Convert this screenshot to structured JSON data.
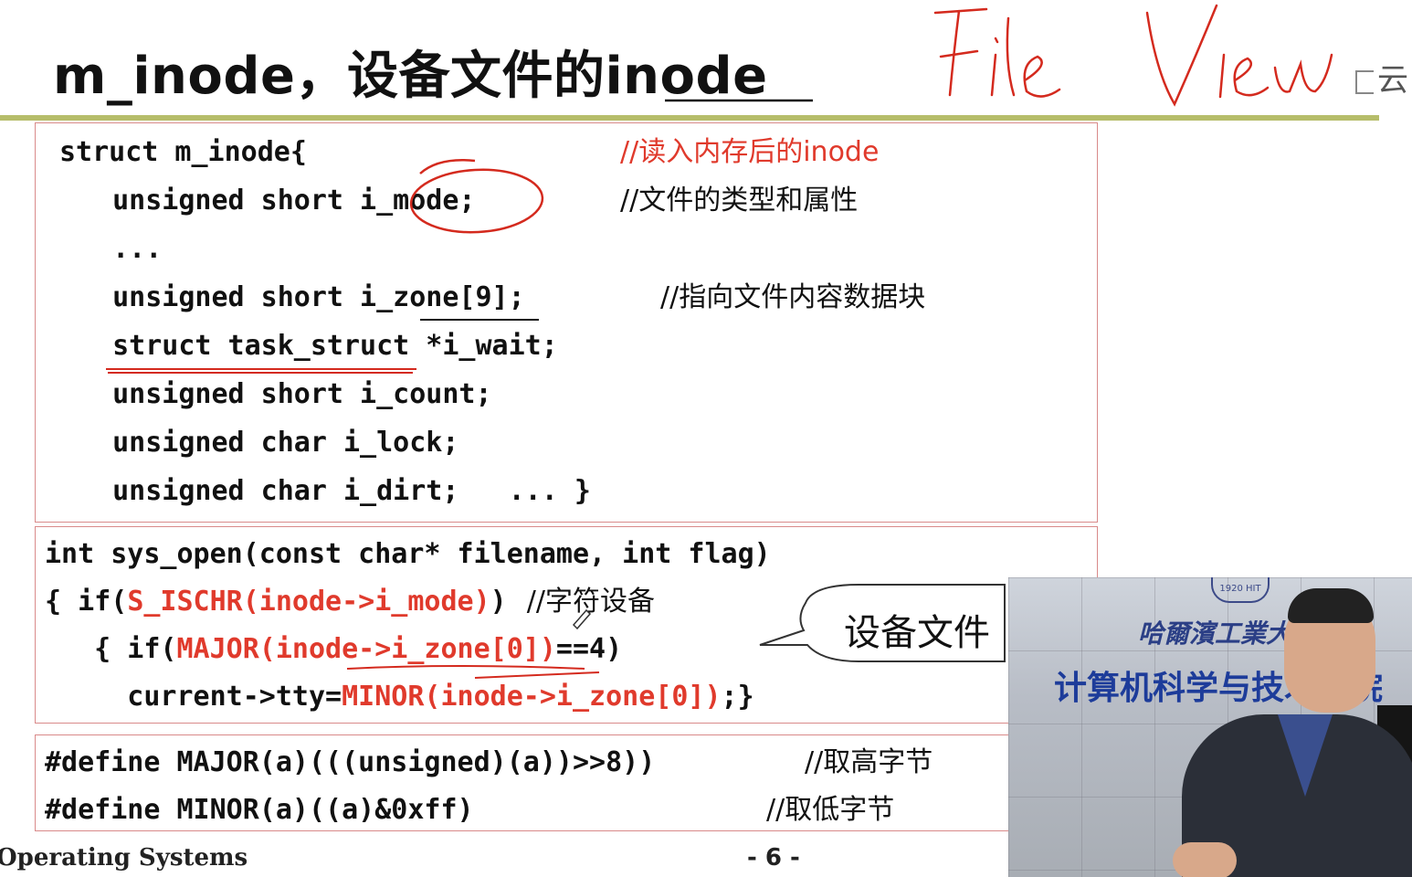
{
  "slide": {
    "title": "m_inode，设备文件的inode",
    "handwriting": "File View",
    "cloud_label": "云",
    "footer_left": "Operating Systems",
    "page_number": "- 6 -",
    "callout": "设备文件"
  },
  "struct_box": {
    "lines": [
      {
        "code": "struct m_inode{",
        "comment": "//读入内存后的inode"
      },
      {
        "code": "  unsigned short i_mode;",
        "comment": "//文件的类型和属性"
      },
      {
        "code": "  ...",
        "comment": ""
      },
      {
        "code": "  unsigned short i_zone[9];",
        "comment": "//指向文件内容数据块"
      },
      {
        "code": "  struct task_struct *i_wait;",
        "comment": ""
      },
      {
        "code": "  unsigned short i_count;",
        "comment": ""
      },
      {
        "code": "  unsigned char i_lock;",
        "comment": ""
      },
      {
        "code": "  unsigned char i_dirt;   ... }",
        "comment": ""
      }
    ]
  },
  "sys_open_box": {
    "line1": "int sys_open(const char* filename, int flag)",
    "line2_a": "{ if(",
    "line2_red": "S_ISCHR(inode->i_mode)",
    "line2_b": ")",
    "line2_comment": "//字符设备",
    "line3_a": "   { if(",
    "line3_red": "MAJOR(inode->i_zone[0])",
    "line3_b": "==4)",
    "line4_a": "     current->tty=",
    "line4_red": "MINOR(inode->i_zone[0])",
    "line4_b": ";}"
  },
  "define_box": {
    "line1_code": "#define MAJOR(a)(((unsigned)(a))>>8))",
    "line1_comment": "//取高字节",
    "line2_code": "#define MINOR(a)((a)&0xff)",
    "line2_comment": "//取低字节"
  },
  "video": {
    "school_name": "哈爾濱工業大",
    "college_name": "计算机科学与技术学院",
    "badge_text": "1920 HIT"
  },
  "colors": {
    "accent_red": "#e03a2c",
    "title_rule": "#b6bd6a",
    "box_border": "#d98a8a"
  }
}
